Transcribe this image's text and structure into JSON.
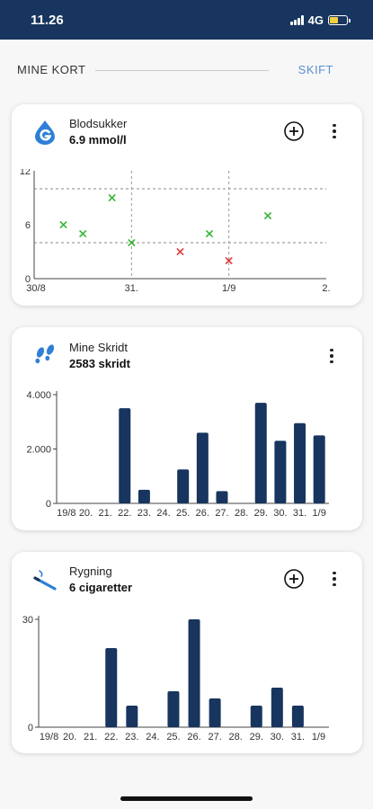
{
  "status_bar": {
    "time": "11.26",
    "network": "4G",
    "battery_level": 0.5
  },
  "section": {
    "title": "MINE KORT",
    "switch_label": "SKIFT"
  },
  "colors": {
    "navy": "#17355e",
    "bar": "#17355e",
    "green": "#35b535",
    "red": "#e2383b",
    "accent": "#5b8fd1"
  },
  "blood_sugar": {
    "title": "Blodsukker",
    "value": "6.9 mmol/l",
    "icon": "blood-sugar-icon",
    "chart_data": {
      "type": "scatter",
      "x_tick_labels": [
        "30/8",
        "31.",
        "1/9",
        "2."
      ],
      "y_tick_labels": [
        "0",
        "6",
        "12"
      ],
      "ylim": [
        0,
        12
      ],
      "reference_lines": [
        4,
        10
      ],
      "points": [
        {
          "x": 30.3,
          "y": 6,
          "status": "normal"
        },
        {
          "x": 30.5,
          "y": 5,
          "status": "normal"
        },
        {
          "x": 30.8,
          "y": 9,
          "status": "normal"
        },
        {
          "x": 31.0,
          "y": 4,
          "status": "normal"
        },
        {
          "x": 31.5,
          "y": 3,
          "status": "low"
        },
        {
          "x": 31.8,
          "y": 5,
          "status": "normal"
        },
        {
          "x": 32.0,
          "y": 2,
          "status": "low"
        },
        {
          "x": 32.4,
          "y": 7,
          "status": "normal"
        }
      ]
    }
  },
  "steps": {
    "title": "Mine Skridt",
    "value": "2583 skridt",
    "icon": "footsteps-icon",
    "chart_data": {
      "type": "bar",
      "categories": [
        "19/8",
        "20.",
        "21.",
        "22.",
        "23.",
        "24.",
        "25.",
        "26.",
        "27.",
        "28.",
        "29.",
        "30.",
        "31.",
        "1/9"
      ],
      "values": [
        0,
        0,
        0,
        3500,
        500,
        0,
        1250,
        2600,
        450,
        0,
        3700,
        2300,
        2950,
        2500
      ],
      "ylim": [
        0,
        4000
      ],
      "y_tick_labels": [
        "0",
        "2.000",
        "4.000"
      ],
      "y_tick_values": [
        0,
        2000,
        4000
      ]
    }
  },
  "smoking": {
    "title": "Rygning",
    "value": "6 cigaretter",
    "icon": "cigarette-icon",
    "chart_data": {
      "type": "bar",
      "categories": [
        "19/8",
        "20.",
        "21.",
        "22.",
        "23.",
        "24.",
        "25.",
        "26.",
        "27.",
        "28.",
        "29.",
        "30.",
        "31.",
        "1/9"
      ],
      "values": [
        0,
        0,
        0,
        22,
        6,
        0,
        10,
        30,
        8,
        0,
        6,
        11,
        6,
        0
      ],
      "ylim": [
        0,
        30
      ],
      "y_tick_labels": [
        "0",
        "30"
      ],
      "y_tick_values": [
        0,
        30
      ]
    }
  }
}
